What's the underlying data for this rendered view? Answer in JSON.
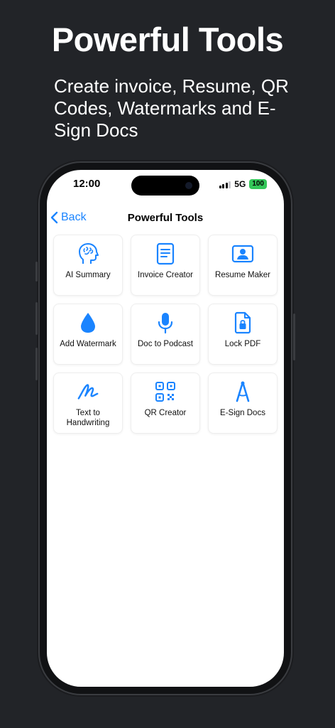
{
  "hero": {
    "title": "Powerful Tools",
    "subtitle": "Create invoice, Resume, QR Codes, Watermarks and E-Sign Docs"
  },
  "status_bar": {
    "time": "12:00",
    "network": "5G",
    "battery": "100",
    "battery_color": "#34c759"
  },
  "nav": {
    "back_label": "Back",
    "title": "Powerful Tools",
    "accent": "#1a84ff"
  },
  "tools": [
    {
      "label": "AI Summary",
      "icon": "brain-head-icon"
    },
    {
      "label": "Invoice Creator",
      "icon": "document-icon"
    },
    {
      "label": "Resume Maker",
      "icon": "person-card-icon"
    },
    {
      "label": "Add Watermark",
      "icon": "drop-icon"
    },
    {
      "label": "Doc to Podcast",
      "icon": "microphone-icon"
    },
    {
      "label": "Lock PDF",
      "icon": "lock-document-icon"
    },
    {
      "label": "Text to Handwriting",
      "icon": "scribble-icon"
    },
    {
      "label": "QR Creator",
      "icon": "qr-code-icon"
    },
    {
      "label": "E-Sign Docs",
      "icon": "pen-compass-icon"
    }
  ]
}
